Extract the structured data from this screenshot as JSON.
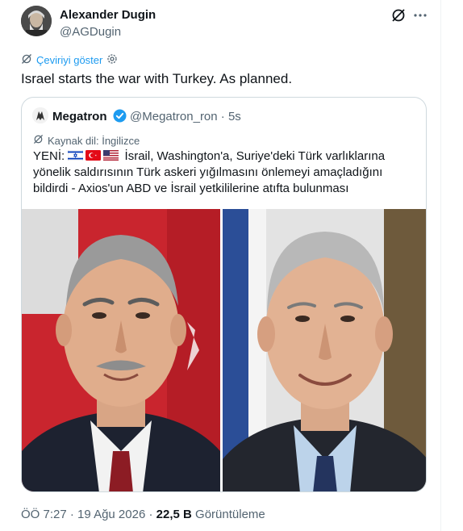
{
  "author": {
    "name": "Alexander Dugin",
    "handle": "@AGDugin"
  },
  "header_icons": [
    "grok-icon",
    "more-icon"
  ],
  "translate_label": "Çeviriyi göster",
  "tweet_text": "Israel starts the war with Turkey. As planned.",
  "quote": {
    "name": "Megatron",
    "handle": "@Megatron_ron",
    "separator": "·",
    "time": "5s",
    "source_label": "Kaynak dil: İngilizce",
    "prefix": "YENİ:",
    "flags": [
      "israel-flag",
      "turkey-flag",
      "usa-flag"
    ],
    "body": "İsrail, Washington'a, Suriye'deki Türk varlıklarına yönelik saldırısının Türk askeri yığılmasını önlemeyi amaçladığını bildirdi - Axios'un ABD ve İsrail yetkililerine atıfta bulunması"
  },
  "footer": {
    "time": "ÖÖ 7:27",
    "separator": "·",
    "date": "19 Ağu 2026",
    "views_count": "22,5 B",
    "views_label": "Görüntüleme"
  },
  "colors": {
    "accent": "#1d9bf0",
    "secondary_text": "#536471",
    "border": "#cfd9de"
  }
}
